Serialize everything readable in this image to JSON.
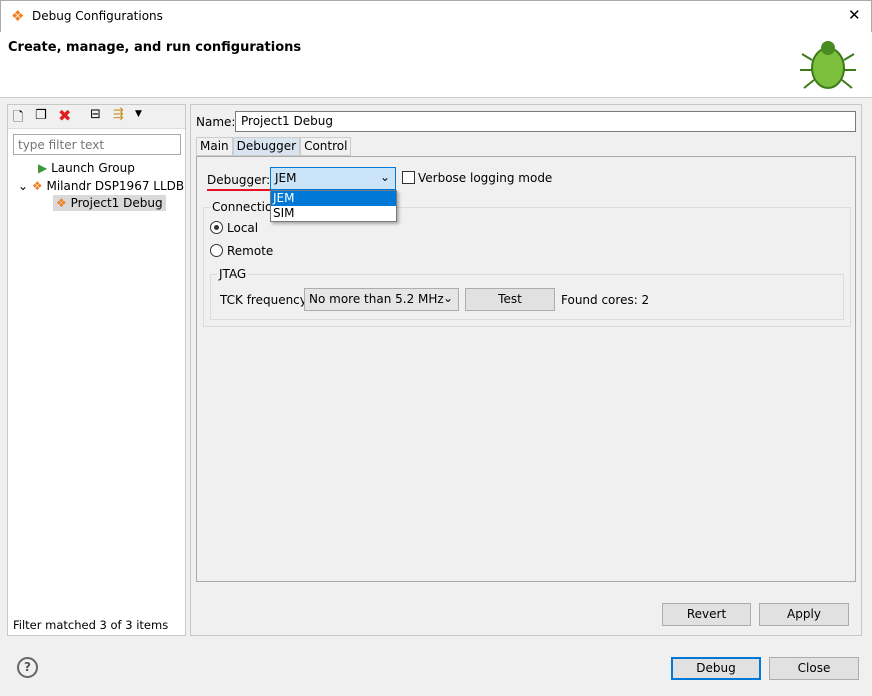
{
  "window": {
    "title": "Debug Configurations",
    "close": "✕"
  },
  "banner": {
    "heading": "Create, manage, and run configurations"
  },
  "left": {
    "filter_placeholder": "type filter text",
    "tree": [
      {
        "label": "Launch Group"
      },
      {
        "label": "Milandr DSP1967 LLDB"
      },
      {
        "label": "Project1 Debug"
      }
    ],
    "status": "Filter matched 3 of 3 items"
  },
  "right": {
    "name_label": "Name:",
    "name_value": "Project1 Debug",
    "tabs": [
      {
        "label": "Main"
      },
      {
        "label": "Debugger"
      },
      {
        "label": "Control"
      }
    ],
    "debugger_label": "Debugger:",
    "debugger_value": "JEM",
    "debugger_options": [
      "JEM",
      "SIM"
    ],
    "verbose_label": "Verbose logging mode",
    "connection_label": "Connection",
    "local_label": "Local",
    "remote_label": "Remote",
    "jtag_label": "JTAG",
    "tck_label": "TCK frequency:",
    "tck_value": "No more than 5.2 MHz",
    "test_label": "Test",
    "found_cores": "Found cores: 2",
    "revert": "Revert",
    "apply": "Apply"
  },
  "footer": {
    "help": "?",
    "debug": "Debug",
    "close": "Close"
  },
  "colors": {
    "accent": "#0078d7",
    "underline": "#e81123",
    "icon_orange": "#f08020"
  }
}
